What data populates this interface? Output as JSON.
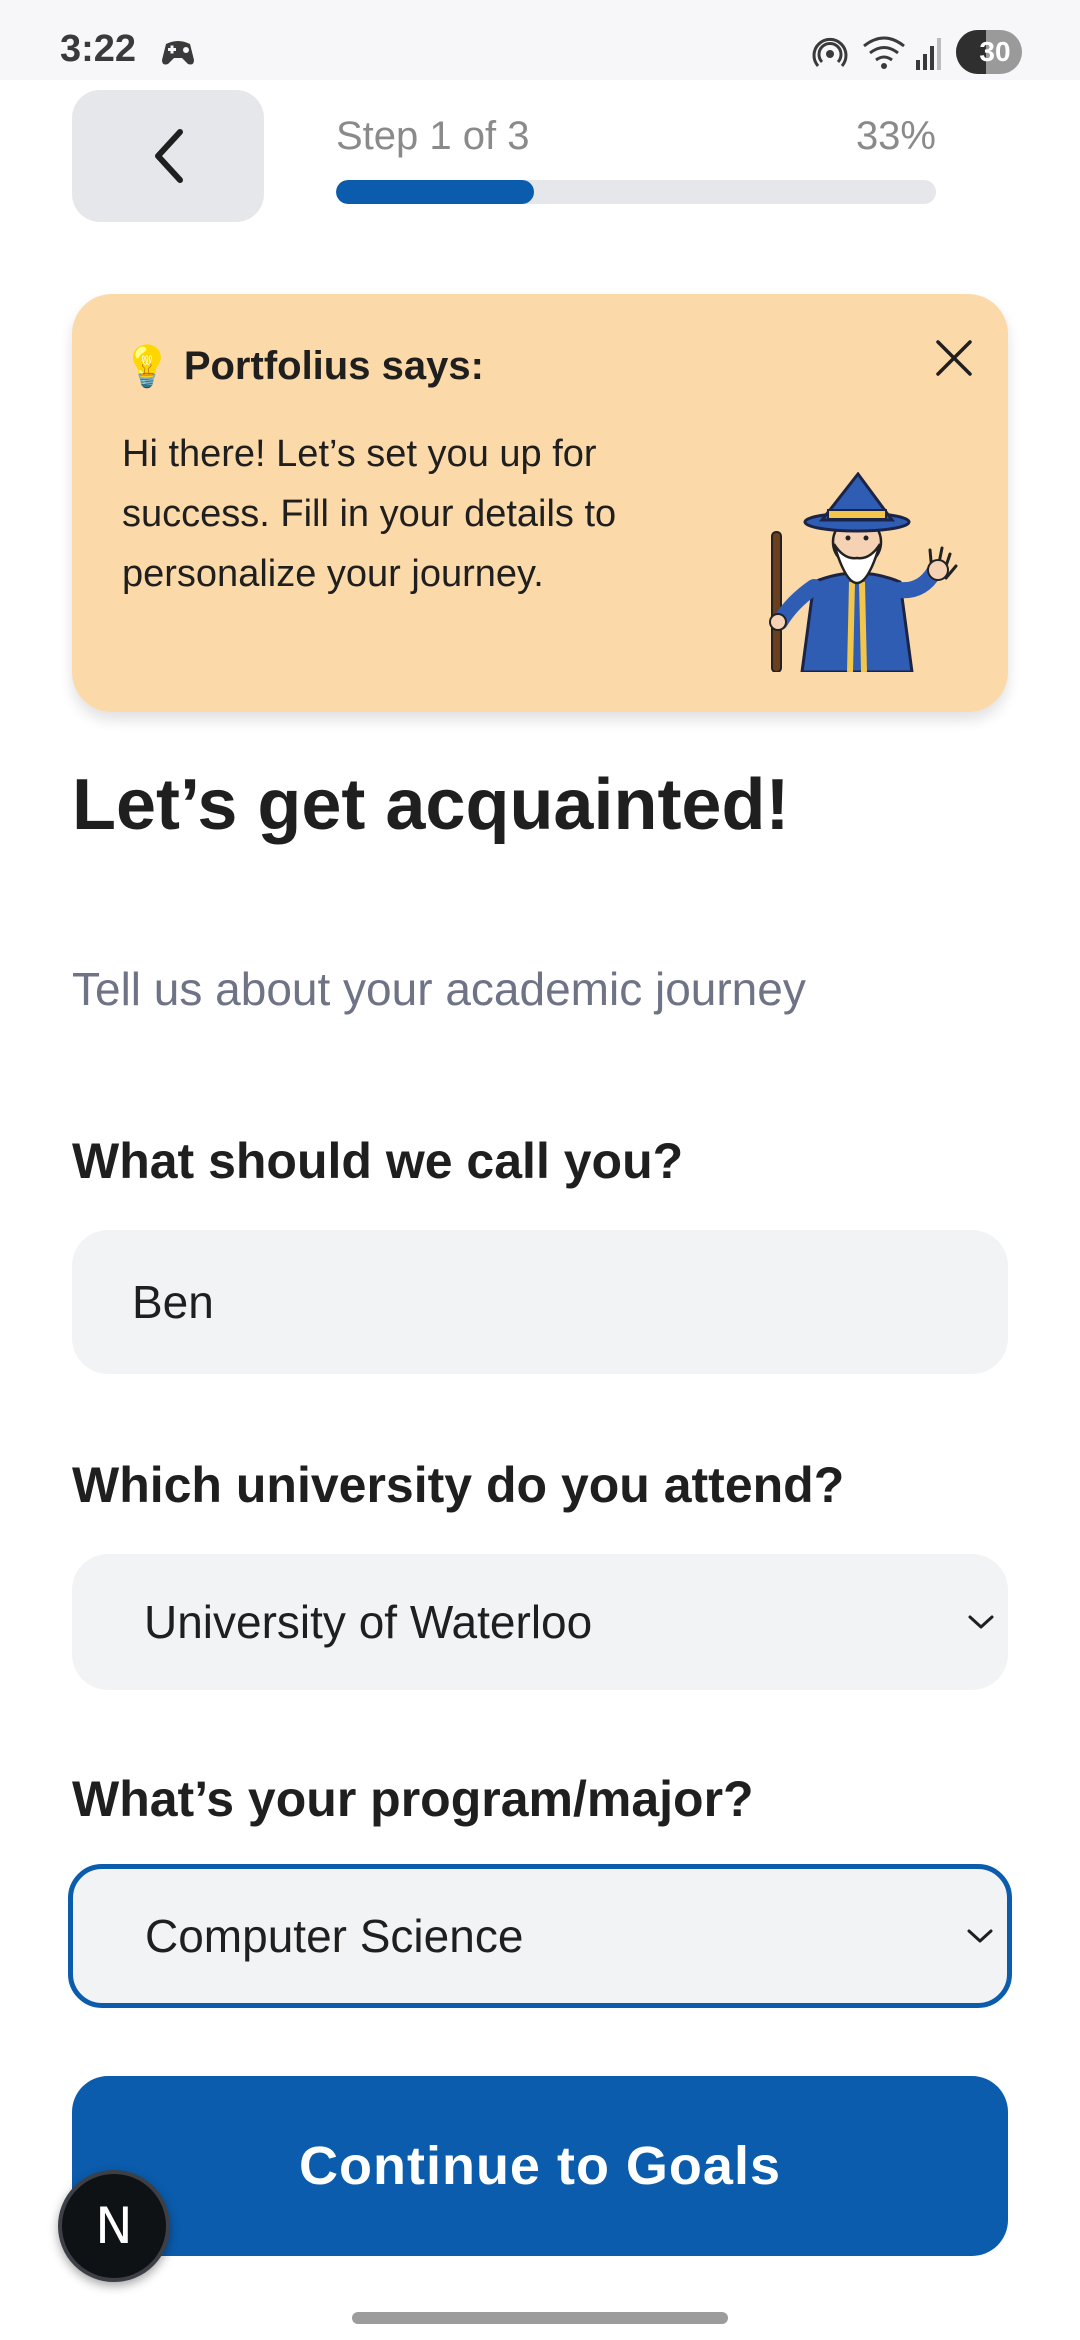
{
  "status_bar": {
    "time": "3:22",
    "battery": "30",
    "icons": [
      "game-controller-icon",
      "hotspot-icon",
      "wifi-icon",
      "signal-icon",
      "battery-icon"
    ]
  },
  "header": {
    "back_icon": "chevron-left-icon",
    "step_label": "Step 1 of 3",
    "progress_percent_label": "33%",
    "progress_fraction": 0.33
  },
  "tip": {
    "emoji": "💡",
    "title": "Portfolius says:",
    "body": "Hi there! Let’s set you up for success. Fill in your details to personalize your journey.",
    "close_icon": "close-icon",
    "illustration": "wizard-illustration",
    "background": "#fcd9a8"
  },
  "page": {
    "title": "Let’s get acquainted!",
    "subtitle": "Tell us about your academic journey"
  },
  "form": {
    "name": {
      "label": "What should we call you?",
      "value": "Ben"
    },
    "university": {
      "label": "Which university do you attend?",
      "value": "University of Waterloo"
    },
    "program": {
      "label": "What’s your program/major?",
      "value": "Computer Science"
    }
  },
  "actions": {
    "continue_label": "Continue to Goals"
  },
  "dev_badge": {
    "label": "N"
  },
  "colors": {
    "primary": "#0b5cad",
    "field_background": "#f2f3f5",
    "subtitle": "#6e7386"
  }
}
